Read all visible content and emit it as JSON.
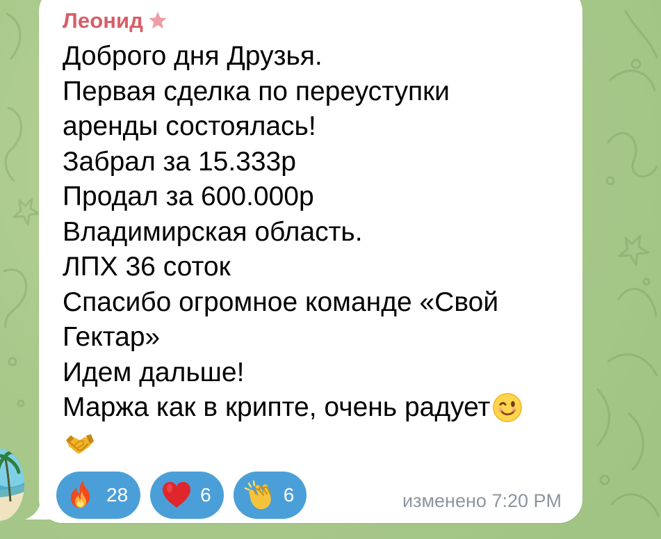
{
  "chat": {
    "background_color": "#a8c98b",
    "bubble_color": "#ffffff"
  },
  "message": {
    "sender": "Леонид",
    "sender_color": "#d85e67",
    "lines": [
      "Доброго дня Друзья.",
      "Первая сделка по переуступки",
      "аренды состоялась!",
      "Забрал за 15.333р",
      "Продал за 600.000р",
      "Владимирская область.",
      "ЛПХ 36 соток",
      "Спасибо огромное команде «Свой",
      "Гектар»",
      "Идем дальше!",
      "Маржа как в крипте, очень радует"
    ],
    "inline_emoji": "winking-face-emoji",
    "next_line_emoji": "handshake-emoji",
    "status": "изменено",
    "time": "7:20 PM"
  },
  "reactions": [
    {
      "icon": "fire-emoji",
      "count": "28"
    },
    {
      "icon": "red-heart-emoji",
      "count": "6"
    },
    {
      "icon": "clapping-hands-emoji",
      "count": "6"
    }
  ],
  "accent_colors": {
    "reaction_background": "#4b9fd8",
    "meta_text": "#8c959e"
  }
}
